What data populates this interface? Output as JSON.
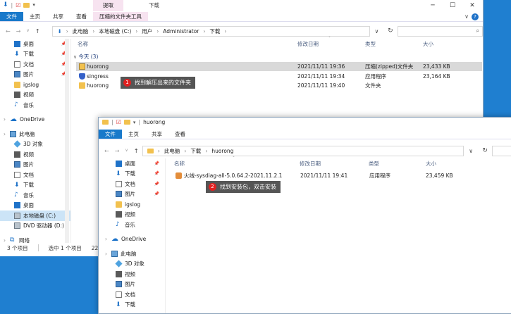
{
  "w1": {
    "title_tool_tab": "提取",
    "title_path": "下载",
    "tabs": [
      "文件",
      "主页",
      "共享",
      "查看",
      "压缩的文件夹工具"
    ],
    "address": [
      "此电脑",
      "本地磁盘 (C:)",
      "用户",
      "Administrator",
      "下载"
    ],
    "sidebar": [
      {
        "label": "桌面",
        "icon": "desktop-icon",
        "pin": true
      },
      {
        "label": "下载",
        "icon": "download-icon",
        "pin": true
      },
      {
        "label": "文档",
        "icon": "document-icon",
        "pin": true
      },
      {
        "label": "图片",
        "icon": "picture-icon",
        "pin": true
      },
      {
        "label": "igslog",
        "icon": "folder-icon",
        "pin": false
      },
      {
        "label": "视频",
        "icon": "video-icon",
        "pin": false
      },
      {
        "label": "音乐",
        "icon": "music-icon",
        "pin": false
      },
      {
        "label": "OneDrive",
        "icon": "onedrive-icon",
        "pin": false
      },
      {
        "label": "此电脑",
        "icon": "this-pc-icon",
        "pin": false
      },
      {
        "label": "3D 对象",
        "icon": "3d-objects-icon",
        "pin": false
      },
      {
        "label": "视频",
        "icon": "video-icon",
        "pin": false
      },
      {
        "label": "图片",
        "icon": "picture-icon",
        "pin": false
      },
      {
        "label": "文档",
        "icon": "document-icon",
        "pin": false
      },
      {
        "label": "下载",
        "icon": "download-icon",
        "pin": false
      },
      {
        "label": "音乐",
        "icon": "music-icon",
        "pin": false
      },
      {
        "label": "桌面",
        "icon": "desktop-icon",
        "pin": false
      },
      {
        "label": "本地磁盘 (C:)",
        "icon": "drive-icon",
        "pin": false
      },
      {
        "label": "DVD 驱动器 (D:)",
        "icon": "dvd-drive-icon",
        "pin": false
      },
      {
        "label": "网络",
        "icon": "network-icon",
        "pin": false
      }
    ],
    "columns": {
      "name": "名称",
      "modified": "修改日期",
      "type": "类型",
      "size": "大小"
    },
    "group": "今天 (3)",
    "files": [
      {
        "name": "huorong",
        "modified": "2021/11/11 19:36",
        "type": "压缩(zipped)文件夹",
        "size": "23,433 KB"
      },
      {
        "name": "singress",
        "modified": "2021/11/11 19:34",
        "type": "应用程序",
        "size": "23,164 KB"
      },
      {
        "name": "huorong",
        "modified": "2021/11/11 19:40",
        "type": "文件夹",
        "size": ""
      }
    ],
    "status": {
      "count": "3 个项目",
      "selected": "选中 1 个项目",
      "size": "22.8 MB"
    },
    "callout": {
      "num": "1",
      "text": "找到解压出来的文件夹"
    }
  },
  "w2": {
    "title_path": "huorong",
    "tabs": [
      "文件",
      "主页",
      "共享",
      "查看"
    ],
    "address": [
      "此电脑",
      "下载",
      "huorong"
    ],
    "sidebar": [
      {
        "label": "桌面",
        "icon": "desktop-icon",
        "pin": true
      },
      {
        "label": "下载",
        "icon": "download-icon",
        "pin": true
      },
      {
        "label": "文档",
        "icon": "document-icon",
        "pin": true
      },
      {
        "label": "图片",
        "icon": "picture-icon",
        "pin": true
      },
      {
        "label": "igslog",
        "icon": "folder-icon",
        "pin": false
      },
      {
        "label": "视频",
        "icon": "video-icon",
        "pin": false
      },
      {
        "label": "音乐",
        "icon": "music-icon",
        "pin": false
      },
      {
        "label": "OneDrive",
        "icon": "onedrive-icon",
        "pin": false
      },
      {
        "label": "此电脑",
        "icon": "this-pc-icon",
        "pin": false
      },
      {
        "label": "3D 对象",
        "icon": "3d-objects-icon",
        "pin": false
      },
      {
        "label": "视频",
        "icon": "video-icon",
        "pin": false
      },
      {
        "label": "图片",
        "icon": "picture-icon",
        "pin": false
      },
      {
        "label": "文档",
        "icon": "document-icon",
        "pin": false
      },
      {
        "label": "下载",
        "icon": "download-icon",
        "pin": false
      }
    ],
    "columns": {
      "name": "名称",
      "modified": "修改日期",
      "type": "类型",
      "size": "大小"
    },
    "files": [
      {
        "name": "火绒-sysdiag-all-5.0.64.2-2021.11.2.1",
        "modified": "2021/11/11 19:41",
        "type": "应用程序",
        "size": "23,459 KB"
      }
    ],
    "callout": {
      "num": "2",
      "text": "找到安装包，双击安装"
    }
  },
  "colors": {
    "accent": "#1979ca",
    "desktop": "#1f7fd0",
    "callout_bg": "#555555",
    "callout_badge": "#e02020"
  }
}
